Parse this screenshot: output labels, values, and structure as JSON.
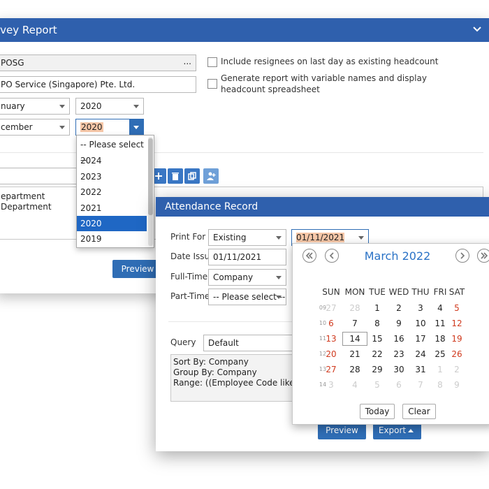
{
  "survey": {
    "title": "rvey Report",
    "company_code": "POSG",
    "company_code_btn": "...",
    "company_name": "PO Service (Singapore) Pte. Ltd.",
    "from_month": "nuary",
    "from_year": "2020",
    "to_month": "cember",
    "to_year": "2020",
    "opt_resignees": "Include resignees on last day as existing headcount",
    "opt_variable": "Generate report with variable names and display headcount spreadsheet",
    "list_items": [
      "epartment",
      "Department"
    ],
    "preview_label": "Preview"
  },
  "year_dropdown": {
    "options": [
      "-- Please select --",
      "2024",
      "2023",
      "2022",
      "2021",
      "2020",
      "2019"
    ],
    "selected": "2020"
  },
  "attendance": {
    "title": "Attendance Record",
    "print_for_label": "Print For",
    "print_for_value": "Existing",
    "date_field_value": "01/11/2021",
    "date_issue_label": "Date Issue",
    "date_issue_value": "01/11/2021",
    "full_time_label": "Full-Time",
    "full_time_value": "Company",
    "part_time_label": "Part-Time",
    "part_time_value": "-- Please select --",
    "query_label": "Query",
    "query_value": "Default",
    "query_text": [
      "Sort By: Company",
      "Group By: Company",
      "Range: ((Employee Code like 'SG%'"
    ],
    "preview_label": "Preview",
    "export_label": "Export"
  },
  "calendar": {
    "month_label": "March 2022",
    "weekdays": [
      "SUN",
      "MON",
      "TUE",
      "WED",
      "THU",
      "FRI",
      "SAT"
    ],
    "week_numbers": [
      "09",
      "10",
      "11",
      "12",
      "13",
      "14"
    ],
    "weeks": [
      [
        "27",
        "28",
        "1",
        "2",
        "3",
        "4",
        "5"
      ],
      [
        "6",
        "7",
        "8",
        "9",
        "10",
        "11",
        "12"
      ],
      [
        "13",
        "14",
        "15",
        "16",
        "17",
        "18",
        "19"
      ],
      [
        "20",
        "21",
        "22",
        "23",
        "24",
        "25",
        "26"
      ],
      [
        "27",
        "28",
        "29",
        "30",
        "31",
        "1",
        "2"
      ],
      [
        "3",
        "4",
        "5",
        "6",
        "7",
        "8",
        "9"
      ]
    ],
    "today_label": "Today",
    "clear_label": "Clear",
    "highlighted_day": "14"
  },
  "colors": {
    "header": "#2f60ad",
    "accent": "#2f6db5",
    "selected": "#1f67c4",
    "weekend": "#d03a1e"
  }
}
